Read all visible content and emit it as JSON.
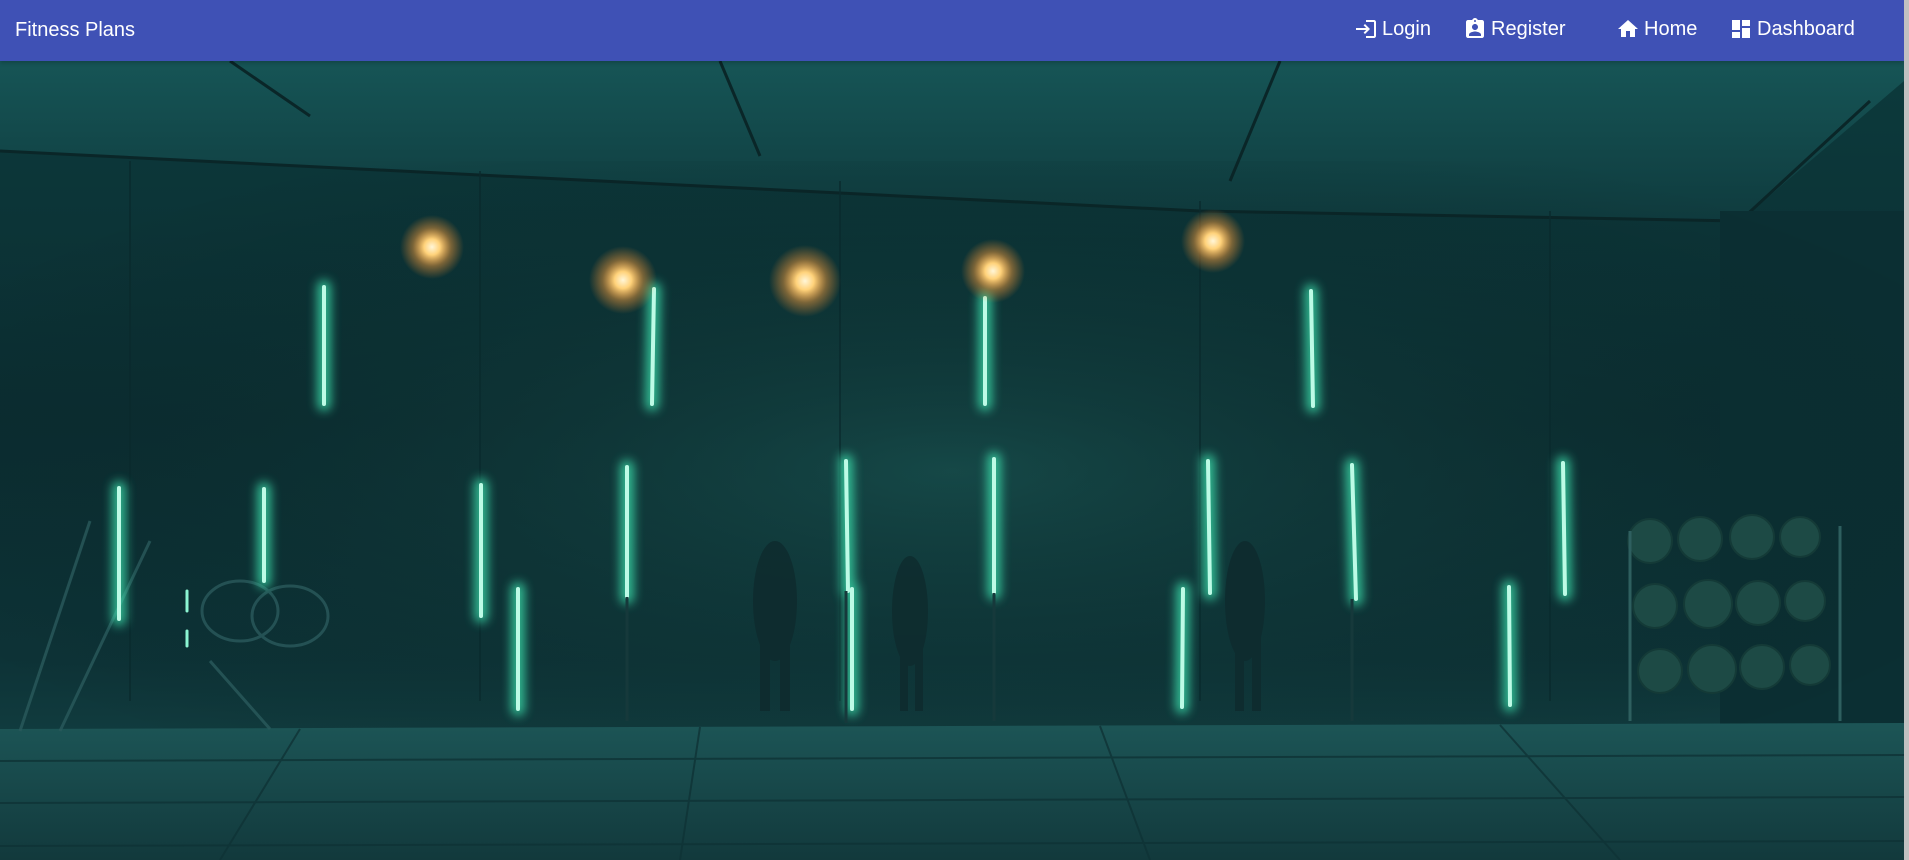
{
  "navbar": {
    "brand": "Fitness Plans",
    "background": "#3f51b5",
    "items": [
      {
        "label": "Login",
        "icon": "login-icon"
      },
      {
        "label": "Register",
        "icon": "assignment-ind-icon"
      },
      {
        "label": "Home",
        "icon": "home-icon"
      },
      {
        "label": "Dashboard",
        "icon": "dashboard-icon"
      }
    ]
  },
  "hero": {
    "media": "background video of dark gym with neon tube lights",
    "accent_colors": {
      "neon": "#3ff0b8",
      "lamp": "#ffb347"
    }
  }
}
